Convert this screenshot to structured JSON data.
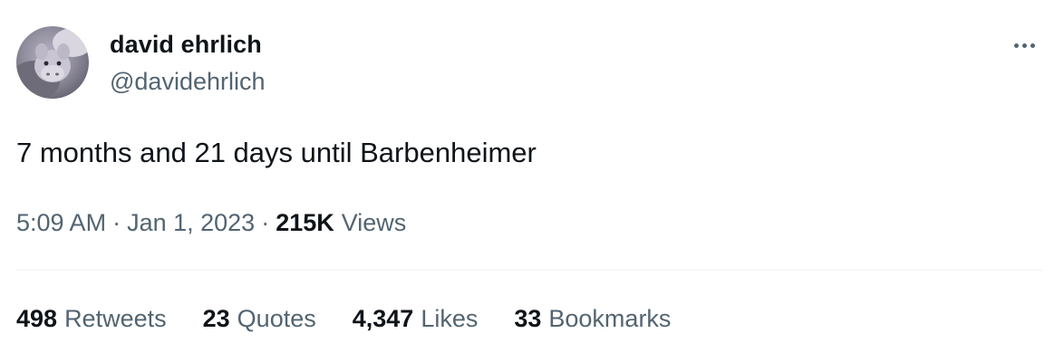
{
  "author": {
    "display_name": "david ehrlich",
    "handle": "@davidehrlich",
    "avatar_icon": "avatar-image"
  },
  "tweet": {
    "text": "7 months and 21 days until Barbenheimer",
    "time": "5:09 AM",
    "separator": "·",
    "date": "Jan 1, 2023",
    "views_count": "215K",
    "views_label": "Views"
  },
  "stats": {
    "retweets": {
      "count": "498",
      "label": "Retweets"
    },
    "quotes": {
      "count": "23",
      "label": "Quotes"
    },
    "likes": {
      "count": "4,347",
      "label": "Likes"
    },
    "bookmarks": {
      "count": "33",
      "label": "Bookmarks"
    }
  },
  "menu": {
    "icon": "more-options-icon"
  },
  "colors": {
    "primary_text": "#0f1419",
    "secondary_text": "#536471",
    "divider": "#eff3f4",
    "background": "#ffffff"
  }
}
